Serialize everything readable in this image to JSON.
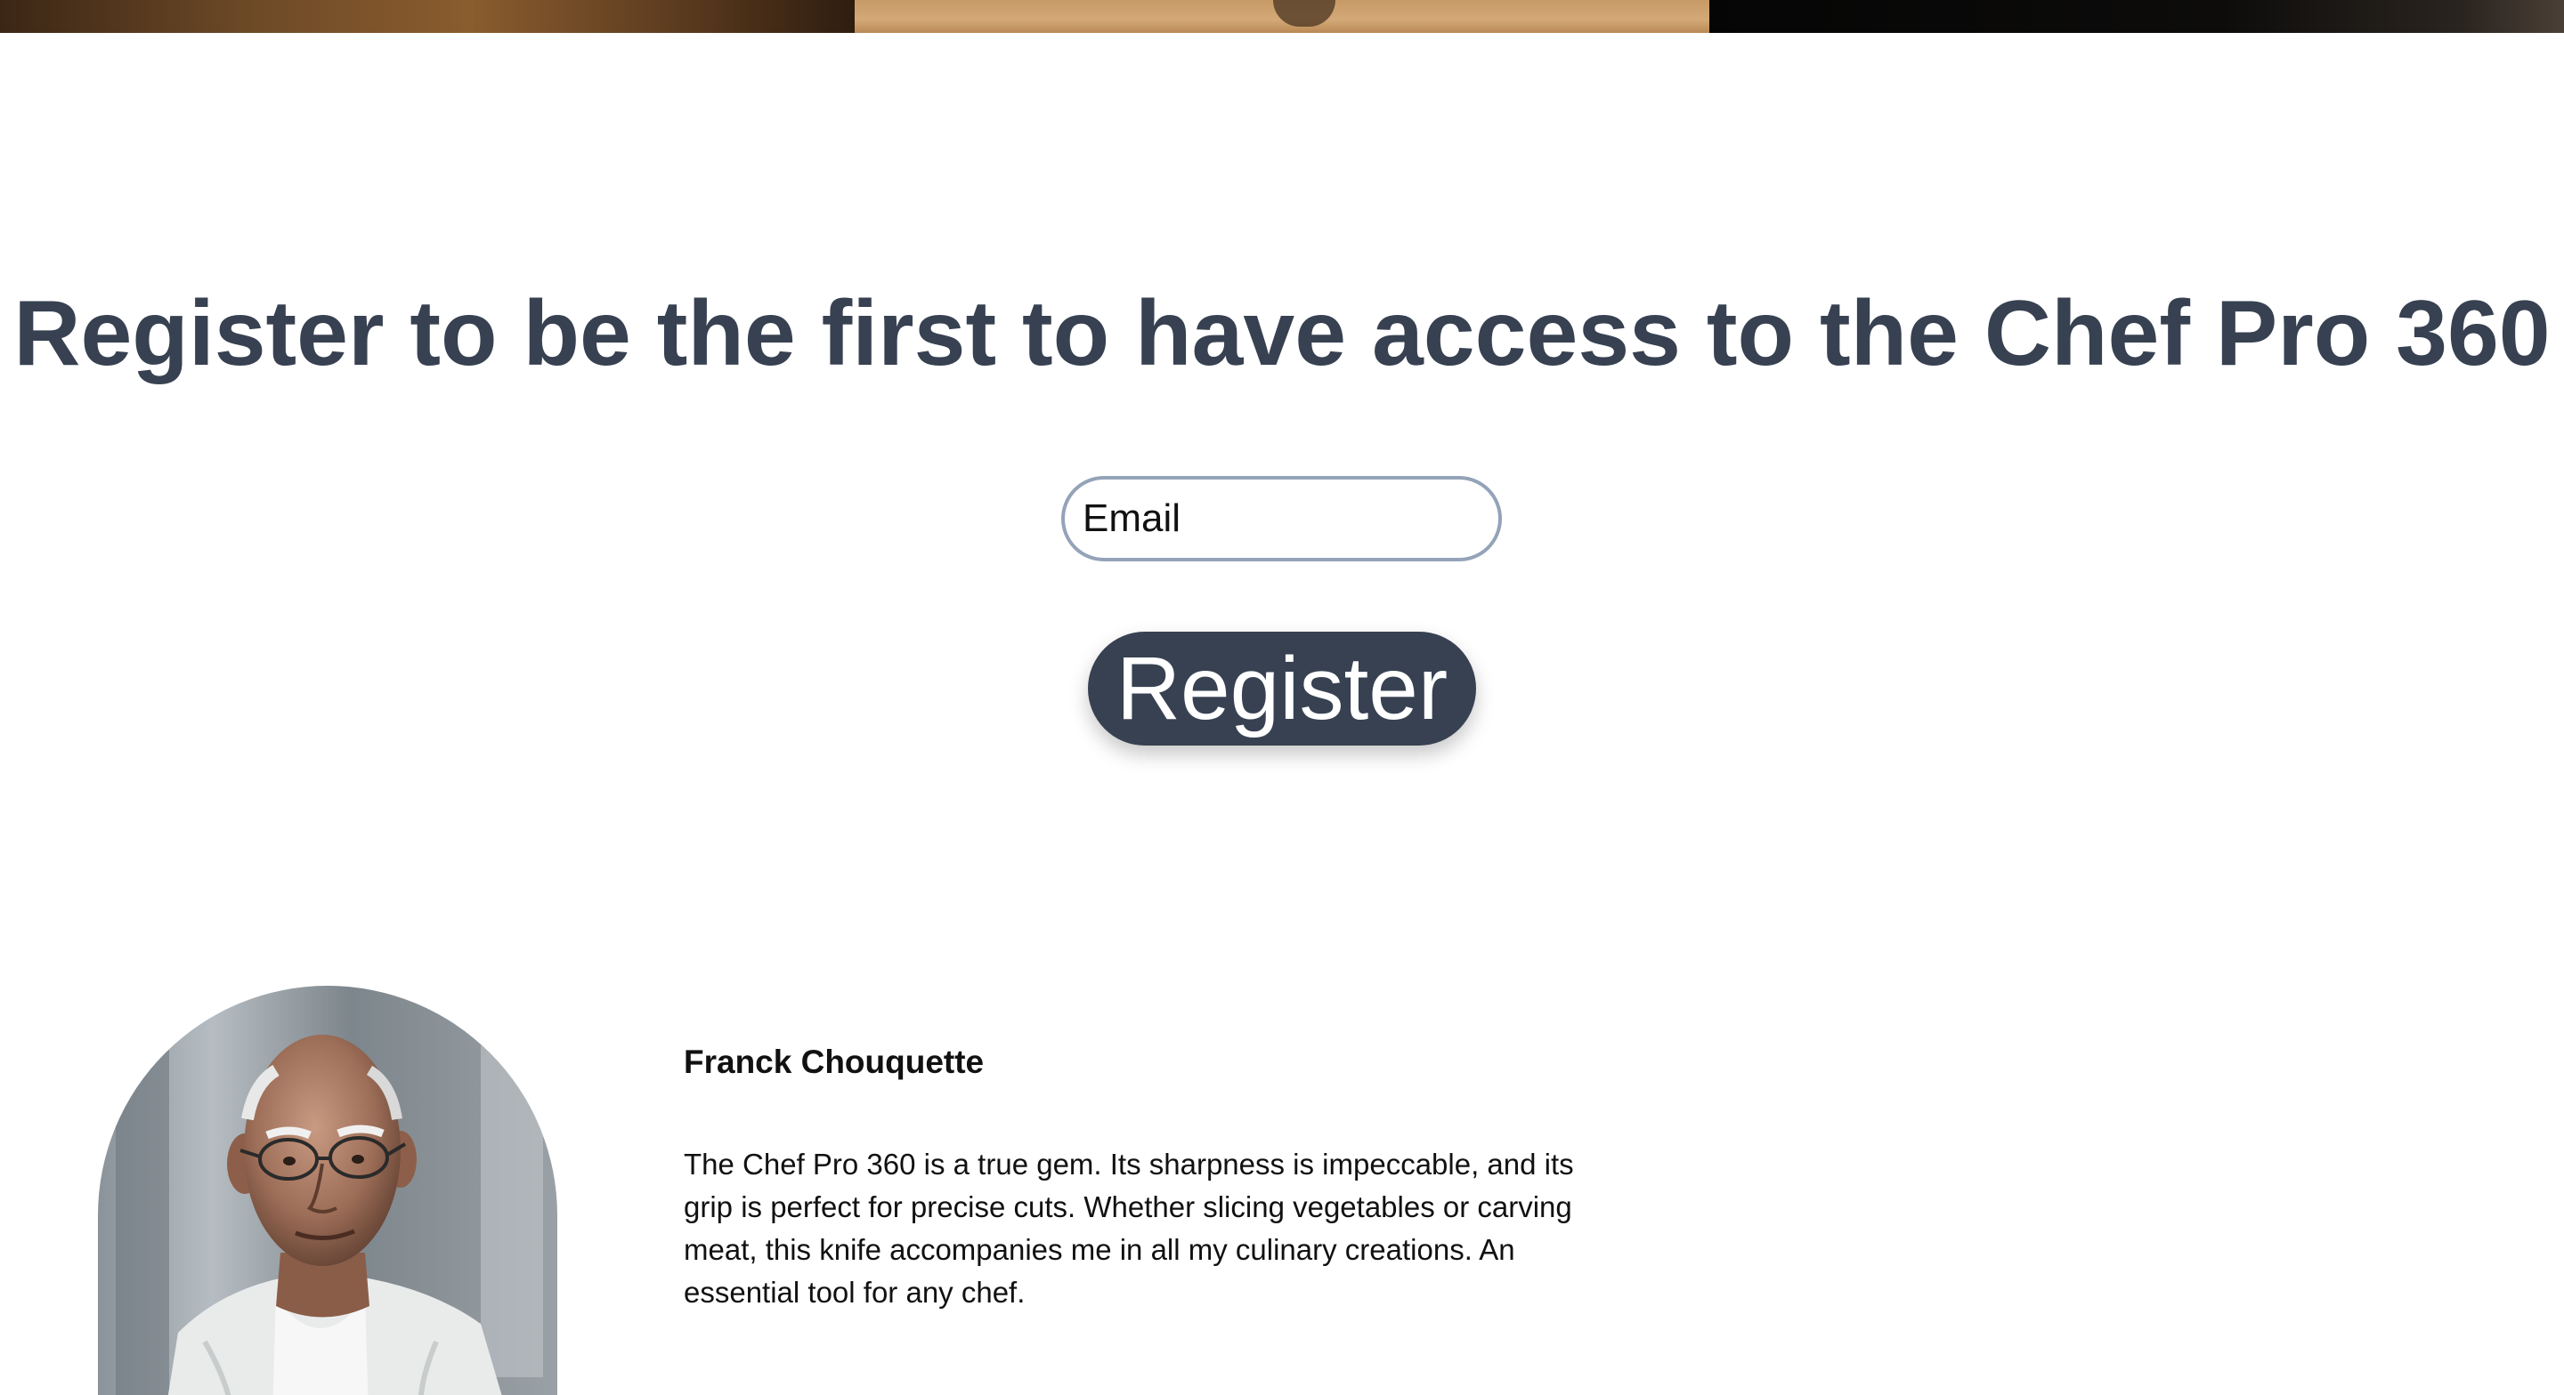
{
  "hero_strip": {
    "panels": [
      "wood-board-image",
      "cutting-board-image",
      "dark-kitchen-image"
    ]
  },
  "register": {
    "title": "Register to be the first to have access to the Chef Pro 360",
    "email_placeholder": "Email",
    "button_label": "Register"
  },
  "testimonial": {
    "name": "Franck Chouquette",
    "quote": "The Chef Pro 360 is a true gem. Its sharpness is impeccable, and its grip is perfect for precise cuts. Whether slicing vegetables or carving meat, this knife accompanies me in all my culinary creations. An essential tool for any chef."
  },
  "colors": {
    "heading": "#374151",
    "button_bg": "#374151",
    "input_border": "#94a3b8"
  }
}
